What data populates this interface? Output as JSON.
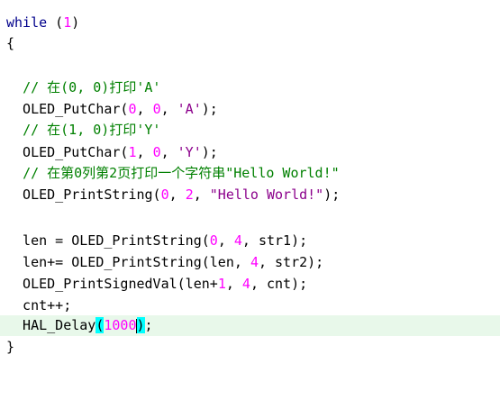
{
  "editor": {
    "lines": [
      {
        "segments": [
          {
            "t": "while",
            "c": "kw"
          },
          {
            "t": " ("
          },
          {
            "t": "1",
            "c": "num"
          },
          {
            "t": ")"
          }
        ]
      },
      {
        "segments": [
          {
            "t": "{"
          }
        ]
      },
      {
        "segments": []
      },
      {
        "segments": [
          {
            "t": "  "
          },
          {
            "t": "// 在(0, 0)打印'A'",
            "c": "cmt"
          }
        ]
      },
      {
        "segments": [
          {
            "t": "  OLED_PutChar("
          },
          {
            "t": "0",
            "c": "num"
          },
          {
            "t": ", "
          },
          {
            "t": "0",
            "c": "num"
          },
          {
            "t": ", "
          },
          {
            "t": "'A'",
            "c": "str"
          },
          {
            "t": ");"
          }
        ]
      },
      {
        "segments": [
          {
            "t": "  "
          },
          {
            "t": "// 在(1, 0)打印'Y'",
            "c": "cmt"
          }
        ]
      },
      {
        "segments": [
          {
            "t": "  OLED_PutChar("
          },
          {
            "t": "1",
            "c": "num"
          },
          {
            "t": ", "
          },
          {
            "t": "0",
            "c": "num"
          },
          {
            "t": ", "
          },
          {
            "t": "'Y'",
            "c": "str"
          },
          {
            "t": ");"
          }
        ]
      },
      {
        "segments": [
          {
            "t": "  "
          },
          {
            "t": "// 在第0列第2页打印一个字符串\"Hello World!\"",
            "c": "cmt"
          }
        ]
      },
      {
        "segments": [
          {
            "t": "  OLED_PrintString("
          },
          {
            "t": "0",
            "c": "num"
          },
          {
            "t": ", "
          },
          {
            "t": "2",
            "c": "num"
          },
          {
            "t": ", "
          },
          {
            "t": "\"Hello World!\"",
            "c": "str"
          },
          {
            "t": ");"
          }
        ]
      },
      {
        "segments": []
      },
      {
        "segments": [
          {
            "t": "  len = OLED_PrintString("
          },
          {
            "t": "0",
            "c": "num"
          },
          {
            "t": ", "
          },
          {
            "t": "4",
            "c": "num"
          },
          {
            "t": ", str1);"
          }
        ]
      },
      {
        "segments": [
          {
            "t": "  len+= OLED_PrintString(len, "
          },
          {
            "t": "4",
            "c": "num"
          },
          {
            "t": ", str2);"
          }
        ]
      },
      {
        "segments": [
          {
            "t": "  OLED_PrintSignedVal(len+"
          },
          {
            "t": "1",
            "c": "num"
          },
          {
            "t": ", "
          },
          {
            "t": "4",
            "c": "num"
          },
          {
            "t": ", cnt);"
          }
        ]
      },
      {
        "segments": [
          {
            "t": "  cnt++;"
          }
        ]
      },
      {
        "current": true,
        "segments": [
          {
            "t": "  HAL_Delay"
          },
          {
            "t": "(",
            "c": "brace-hl"
          },
          {
            "t": "1000",
            "c": "num"
          },
          {
            "t": "|",
            "c": "caret"
          },
          {
            "t": ")",
            "c": "brace-hl"
          },
          {
            "t": ";"
          }
        ]
      },
      {
        "segments": [
          {
            "t": "}"
          }
        ]
      }
    ]
  }
}
